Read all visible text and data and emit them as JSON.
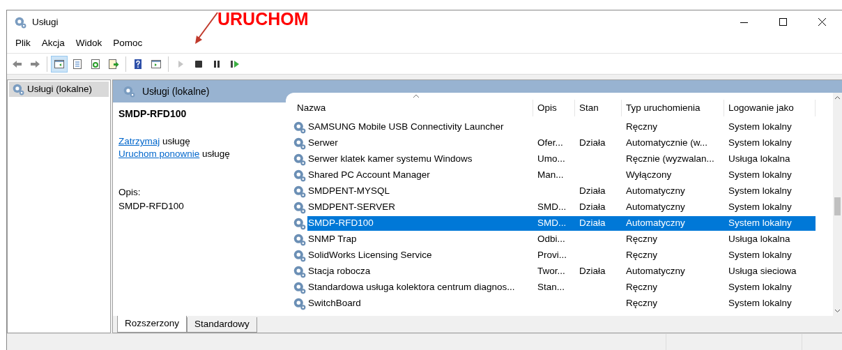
{
  "window": {
    "title": "Usługi"
  },
  "menu": [
    "Plik",
    "Akcja",
    "Widok",
    "Pomoc"
  ],
  "toolbar": [
    {
      "kind": "back",
      "disabled": false,
      "selected": false
    },
    {
      "kind": "forward",
      "disabled": false,
      "selected": false
    },
    {
      "kind": "tree",
      "disabled": false,
      "selected": true
    },
    {
      "kind": "properties",
      "disabled": false,
      "selected": false
    },
    {
      "kind": "refresh",
      "disabled": false,
      "selected": false
    },
    {
      "kind": "export",
      "disabled": false,
      "selected": false
    },
    {
      "kind": "help",
      "disabled": false,
      "selected": false
    },
    {
      "kind": "actionpane",
      "disabled": false,
      "selected": false
    },
    {
      "kind": "play",
      "disabled": true,
      "selected": false
    },
    {
      "kind": "stop",
      "disabled": false,
      "selected": false
    },
    {
      "kind": "pause",
      "disabled": false,
      "selected": false
    },
    {
      "kind": "resume",
      "disabled": false,
      "selected": false
    }
  ],
  "annotation": {
    "text": "URUCHOM"
  },
  "tree": [
    {
      "label": "Usługi (lokalne)",
      "selected": true
    }
  ],
  "pane_title": "Usługi (lokalne)",
  "details": {
    "service_name": "SMDP-RFD100",
    "actions": [
      {
        "link": "Zatrzymaj",
        "text": "usługę"
      },
      {
        "link": "Uruchom ponownie",
        "text": "usługę"
      }
    ],
    "description_label": "Opis:",
    "description": "SMDP-RFD100"
  },
  "table": {
    "columns": [
      "Nazwa",
      "Opis",
      "Stan",
      "Typ uruchomienia",
      "Logowanie jako"
    ],
    "rows": [
      {
        "name": "SAMSUNG Mobile USB Connectivity Launcher",
        "description": "",
        "status": "",
        "startup": "Ręczny",
        "logon": "System lokalny",
        "selected": false
      },
      {
        "name": "Serwer",
        "description": "Ofer...",
        "status": "Działa",
        "startup": "Automatycznie (w...",
        "logon": "System lokalny",
        "selected": false
      },
      {
        "name": "Serwer klatek kamer systemu Windows",
        "description": "Umo...",
        "status": "",
        "startup": "Ręcznie (wyzwalan...",
        "logon": "Usługa lokalna",
        "selected": false
      },
      {
        "name": "Shared PC Account Manager",
        "description": "Man...",
        "status": "",
        "startup": "Wyłączony",
        "logon": "System lokalny",
        "selected": false
      },
      {
        "name": "SMDPENT-MYSQL",
        "description": "",
        "status": "Działa",
        "startup": "Automatyczny",
        "logon": "System lokalny",
        "selected": false
      },
      {
        "name": "SMDPENT-SERVER",
        "description": "SMD...",
        "status": "Działa",
        "startup": "Automatyczny",
        "logon": "System lokalny",
        "selected": false
      },
      {
        "name": "SMDP-RFD100",
        "description": "SMD...",
        "status": "Działa",
        "startup": "Automatyczny",
        "logon": "System lokalny",
        "selected": true
      },
      {
        "name": "SNMP Trap",
        "description": "Odbi...",
        "status": "",
        "startup": "Ręczny",
        "logon": "Usługa lokalna",
        "selected": false
      },
      {
        "name": "SolidWorks Licensing Service",
        "description": "Provi...",
        "status": "",
        "startup": "Ręczny",
        "logon": "System lokalny",
        "selected": false
      },
      {
        "name": "Stacja robocza",
        "description": "Twor...",
        "status": "Działa",
        "startup": "Automatyczny",
        "logon": "Usługa sieciowa",
        "selected": false
      },
      {
        "name": "Standardowa usługa kolektora centrum diagnos...",
        "description": "Stan...",
        "status": "",
        "startup": "Ręczny",
        "logon": "System lokalny",
        "selected": false
      },
      {
        "name": "SwitchBoard",
        "description": "",
        "status": "",
        "startup": "Ręczny",
        "logon": "System lokalny",
        "selected": false
      }
    ]
  },
  "bottom_tabs": [
    {
      "label": "Rozszerzony",
      "selected": true
    },
    {
      "label": "Standardowy",
      "selected": false
    }
  ]
}
